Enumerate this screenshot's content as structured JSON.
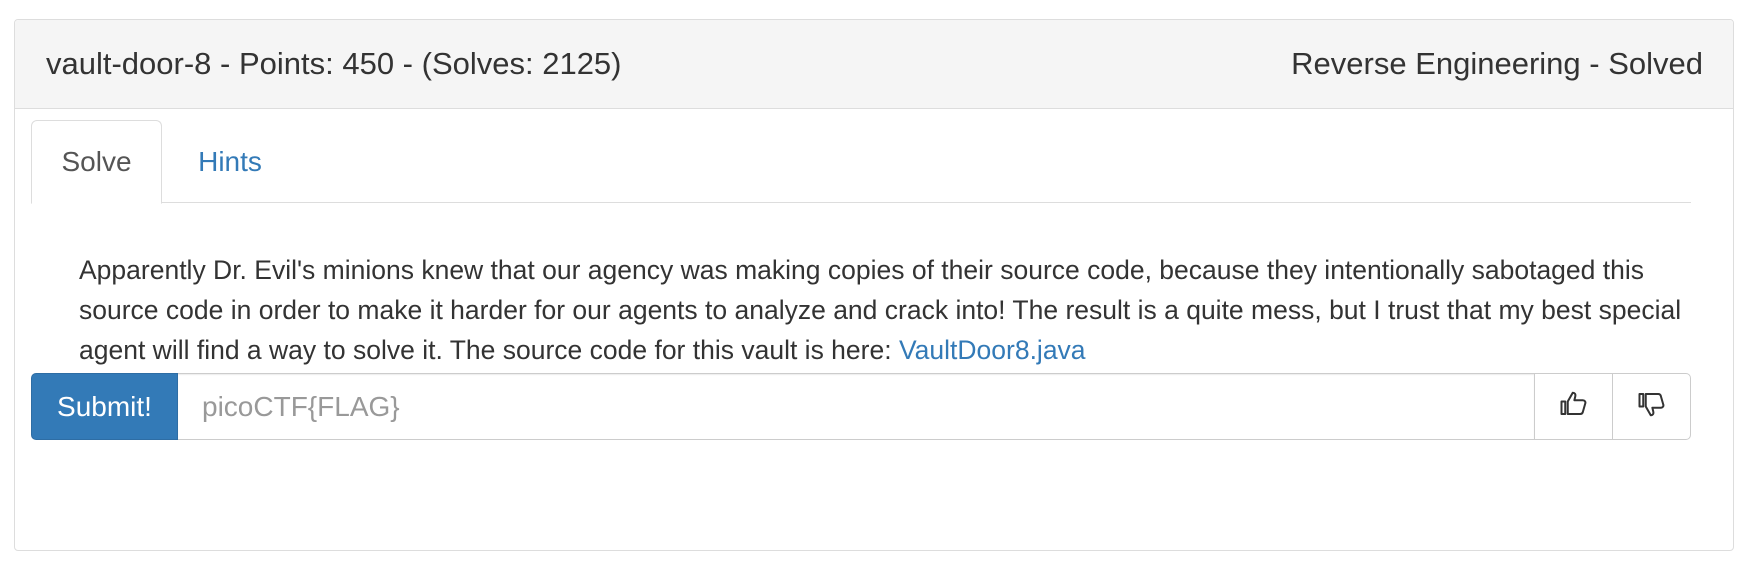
{
  "challenge": {
    "heading_left": "vault-door-8 - Points: 450 - (Solves: 2125)",
    "heading_right": "Reverse Engineering - Solved"
  },
  "tabs": [
    {
      "label": "Solve",
      "active": true
    },
    {
      "label": "Hints",
      "active": false
    }
  ],
  "description": {
    "text": "Apparently Dr. Evil's minions knew that our agency was making copies of their source code, because they intentionally sabotaged this source code in order to make it harder for our agents to analyze and crack into! The result is a quite mess, but I trust that my best special agent will find a way to solve it. The source code for this vault is here: ",
    "link_text": "VaultDoor8.java"
  },
  "form": {
    "submit_label": "Submit!",
    "flag_placeholder": "picoCTF{FLAG}",
    "flag_value": ""
  },
  "icons": {
    "upvote": "thumbs-up-icon",
    "downvote": "thumbs-down-icon"
  },
  "colors": {
    "accent": "#337ab7",
    "heading_bg": "#f5f5f5",
    "border": "#dddddd"
  }
}
